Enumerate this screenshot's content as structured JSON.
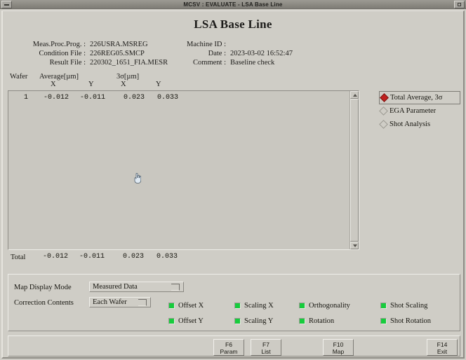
{
  "window": {
    "title": "MCSV : EVALUATE - LSA Base Line",
    "minimize_icon": "minimize-icon",
    "maximize_icon": "maximize-icon"
  },
  "page": {
    "title": "LSA Base Line"
  },
  "info": {
    "left": [
      {
        "label": "Meas.Proc.Prog. :",
        "value": "226USRA.MSREG"
      },
      {
        "label": "Condition File :",
        "value": "226REG05.SMCP"
      },
      {
        "label": "Result File :",
        "value": "220302_1651_FIA.MESR"
      }
    ],
    "right": [
      {
        "label": "Machine ID :",
        "value": ""
      },
      {
        "label": "Date :",
        "value": "2023-03-02 16:52:47"
      },
      {
        "label": "Comment :",
        "value": "Baseline check"
      }
    ]
  },
  "table": {
    "headers": {
      "wafer": "Wafer",
      "average": "Average[µm]",
      "sigma": "3σ[µm]",
      "avg_x": "X",
      "avg_y": "Y",
      "sig_x": "X",
      "sig_y": "Y"
    },
    "rows": [
      {
        "wafer": "1",
        "avg_x": "-0.012",
        "avg_y": "-0.011",
        "sig_x": "0.023",
        "sig_y": "0.033"
      }
    ],
    "total": {
      "label": "Total",
      "avg_x": "-0.012",
      "avg_y": "-0.011",
      "sig_x": "0.023",
      "sig_y": "0.033"
    }
  },
  "scrollbar": {
    "up_icon": "scroll-up-arrow-icon",
    "down_icon": "scroll-down-arrow-icon"
  },
  "view_modes": {
    "items": [
      {
        "label": "Total Average, 3σ",
        "selected": true
      },
      {
        "label": "EGA Parameter",
        "selected": false
      },
      {
        "label": "Shot Analysis",
        "selected": false
      }
    ]
  },
  "settings": {
    "map_display_mode_label": "Map Display Mode",
    "map_display_mode_value": "Measured Data",
    "correction_contents_label": "Correction Contents",
    "correction_contents_value": "Each Wafer",
    "checkboxes": [
      [
        {
          "label": "Offset X",
          "checked": true
        },
        {
          "label": "Scaling X",
          "checked": true
        },
        {
          "label": "Orthogonality",
          "checked": true
        },
        {
          "label": "Shot Scaling",
          "checked": true
        }
      ],
      [
        {
          "label": "Offset Y",
          "checked": true
        },
        {
          "label": "Scaling Y",
          "checked": true
        },
        {
          "label": "Rotation",
          "checked": true
        },
        {
          "label": "Shot Rotation",
          "checked": true
        }
      ]
    ]
  },
  "buttons": [
    {
      "key": "F6",
      "label": "Param"
    },
    {
      "key": "F7",
      "label": "List"
    },
    {
      "key": "F10",
      "label": "Map"
    },
    {
      "key": "F14",
      "label": "Exit"
    }
  ],
  "colors": {
    "accent_selected": "#c0201e",
    "checkbox_green": "#17cc3d",
    "window_bg": "#cfcdc6"
  },
  "cursor": {
    "name": "hand-pointer-cursor"
  }
}
